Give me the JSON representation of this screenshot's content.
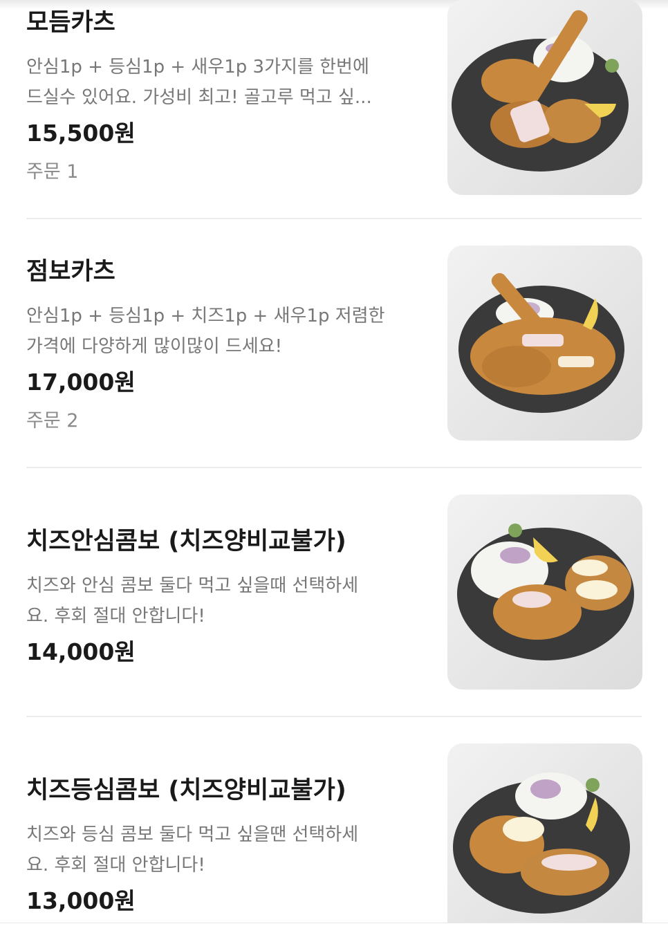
{
  "menu": {
    "items": [
      {
        "name": "모듬카츠",
        "desc_lines": [
          "안심1p + 등심1p + 새우1p 3가지를 한번에",
          "드실수 있어요. 가성비 최고! 골고루 먹고 싶..."
        ],
        "price": "15,500원",
        "orders": "주문 1",
        "image": "mixed-katsu-plate-photo"
      },
      {
        "name": "점보카츠",
        "desc_lines": [
          "안심1p + 등심1p + 치즈1p + 새우1p 저렴한",
          "가격에 다양하게 많이많이 드세요!"
        ],
        "price": "17,000원",
        "orders": "주문 2",
        "image": "jumbo-katsu-plate-photo"
      },
      {
        "name": "치즈안심콤보 (치즈양비교불가)",
        "desc_lines": [
          "치즈와 안심 콤보 둘다 먹고 싶을때 선택하세",
          "요. 후회 절대 안합니다!"
        ],
        "price": "14,000원",
        "image": "cheese-tenderloin-combo-photo"
      },
      {
        "name": "치즈등심콤보 (치즈양비교불가)",
        "desc_lines": [
          "치즈와 등심 콤보 둘다 먹고 싶을땐 선택하세",
          "요. 후회 절대 안합니다!"
        ],
        "price": "13,000원",
        "image": "cheese-sirloin-combo-photo"
      }
    ]
  },
  "colors": {
    "text_primary": "#1a1a1a",
    "text_secondary": "#777777",
    "text_muted": "#8a8a8a",
    "divider": "#ececec",
    "plate": "#3a3a3a",
    "cutlet": "#c8893f"
  }
}
